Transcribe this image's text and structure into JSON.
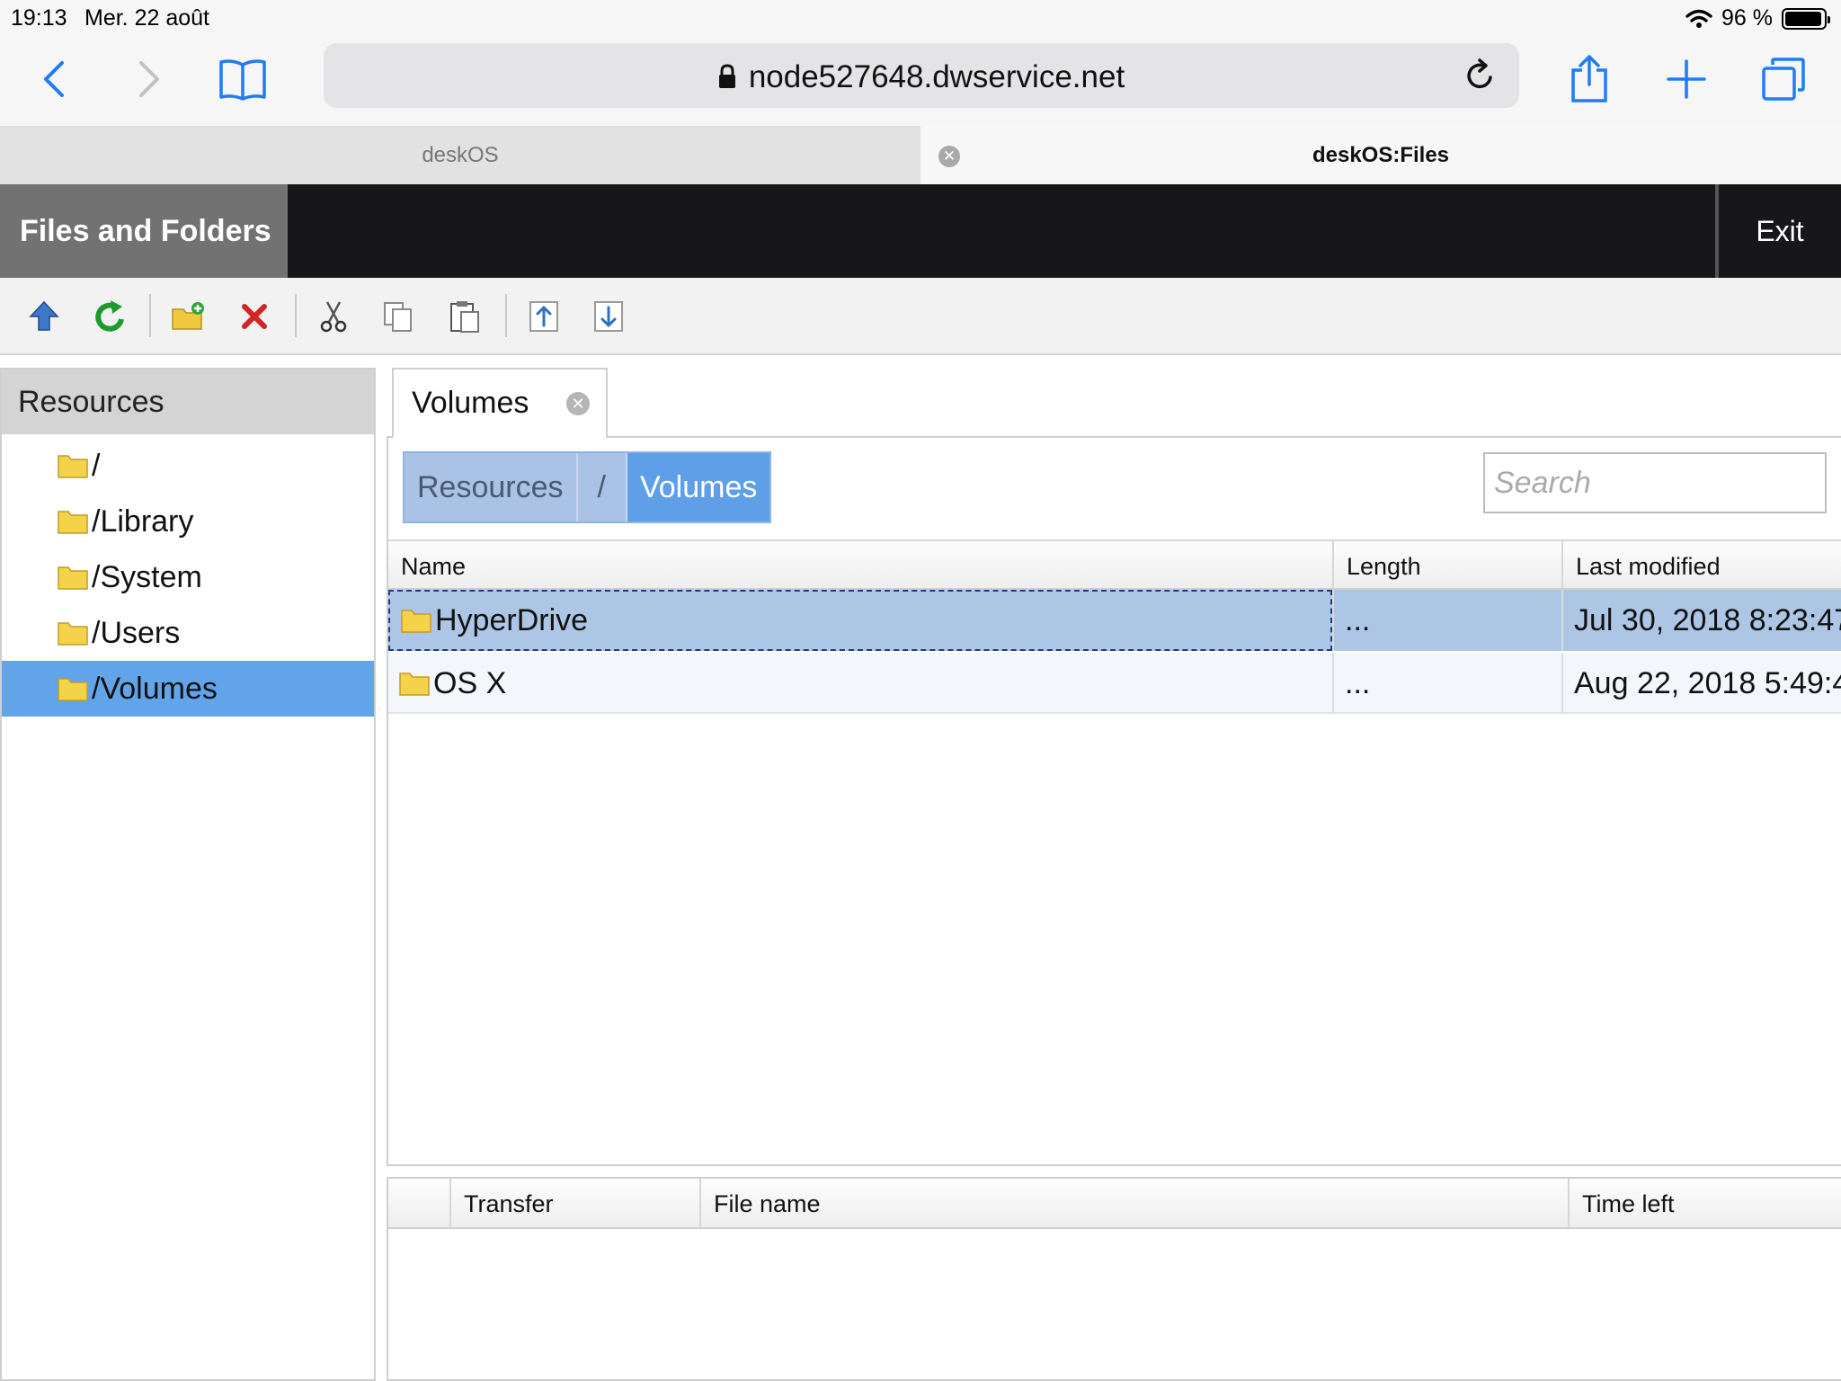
{
  "status_bar": {
    "time": "19:13",
    "date": "Mer. 22 août",
    "battery": "96 %",
    "battery_level": 0.96
  },
  "safari": {
    "url": "node527648.dwservice.net",
    "icons": [
      "back-icon",
      "forward-icon",
      "bookmarks-icon",
      "lock-icon",
      "reload-icon",
      "share-icon",
      "new-tab-icon",
      "tabs-icon"
    ]
  },
  "tabs": [
    {
      "label": "deskOS",
      "active": false
    },
    {
      "label": "deskOS:Files",
      "active": true
    }
  ],
  "app": {
    "title": "Files and Folders",
    "exit_label": "Exit",
    "accent": "#62a4ea"
  },
  "toolbar": {
    "icons": [
      "parent-folder-icon",
      "refresh-icon",
      "new-folder-icon",
      "delete-icon",
      "cut-icon",
      "copy-icon",
      "paste-icon",
      "upload-icon",
      "download-icon"
    ]
  },
  "sidebar": {
    "title": "Resources",
    "items": [
      {
        "label": "/"
      },
      {
        "label": "/Library"
      },
      {
        "label": "/System"
      },
      {
        "label": "/Users"
      },
      {
        "label": "/Volumes"
      }
    ],
    "selected": "/Volumes"
  },
  "main": {
    "tab_label": "Volumes",
    "breadcrumb": [
      "Resources",
      "/",
      "Volumes"
    ],
    "search_placeholder": "Search",
    "columns": [
      "Name",
      "Length",
      "Last modified"
    ],
    "rows": [
      {
        "name": "HyperDrive",
        "length": "...",
        "modified": "Jul 30, 2018 8:23:47"
      },
      {
        "name": "OS X",
        "length": "...",
        "modified": "Aug 22, 2018 5:49:4"
      }
    ]
  },
  "transfers": {
    "columns": [
      "Transfer",
      "File name",
      "Time left"
    ]
  }
}
